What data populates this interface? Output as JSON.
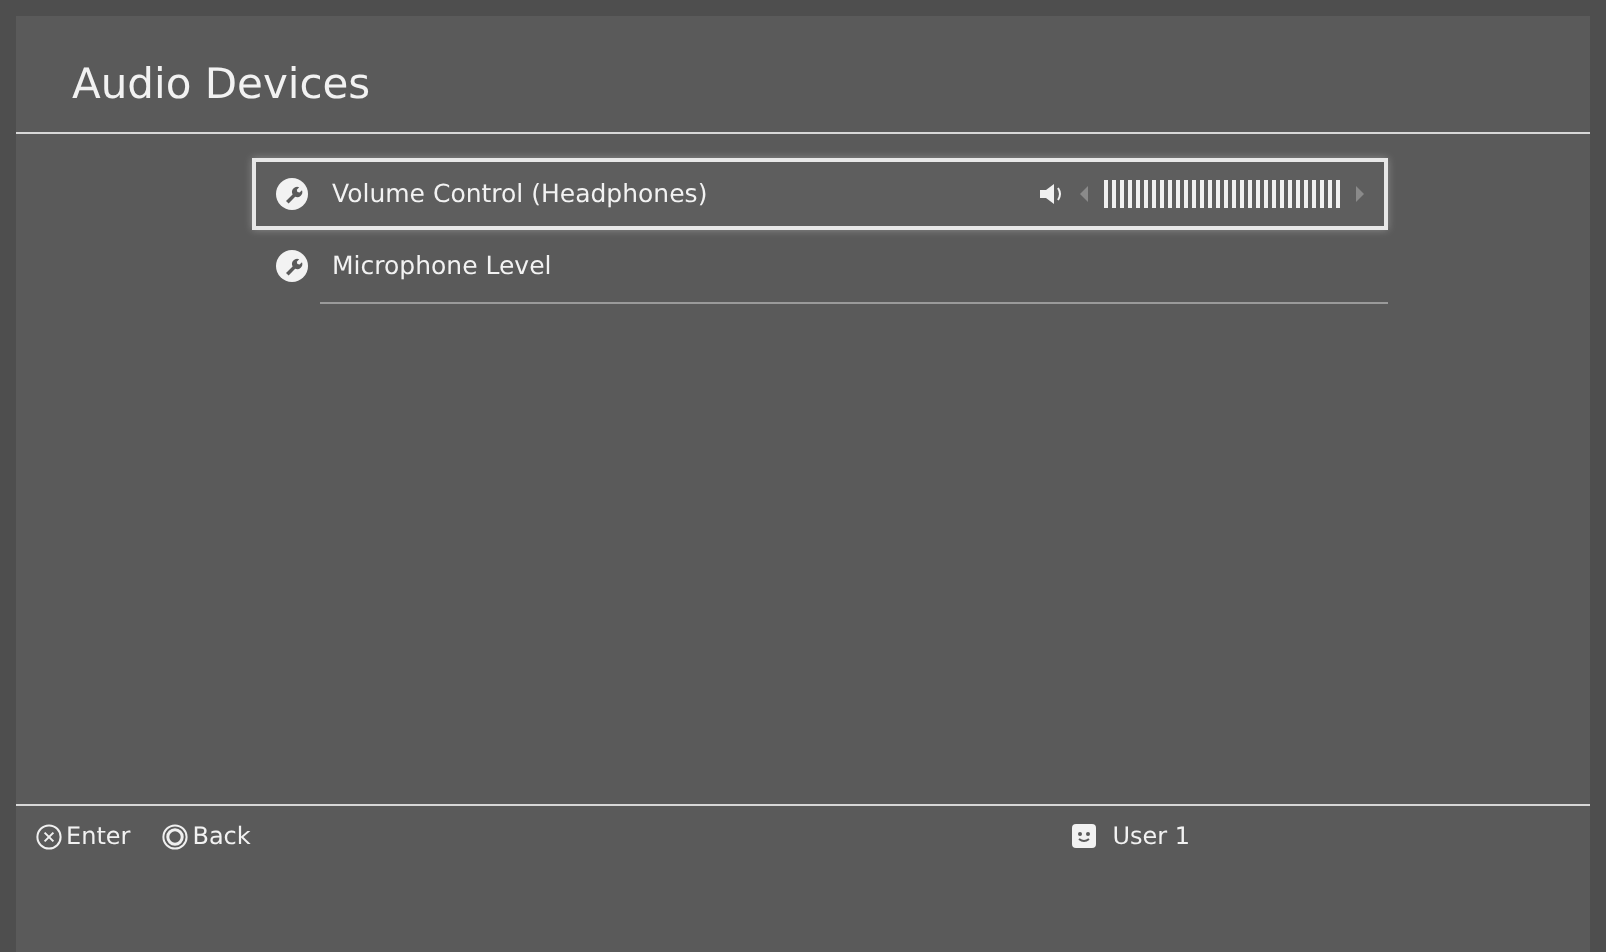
{
  "title": "Audio Devices",
  "items": [
    {
      "label": "Volume Control (Headphones)",
      "selected": true,
      "kind": "slider"
    },
    {
      "label": "Microphone Level",
      "selected": false,
      "kind": "plain"
    }
  ],
  "footer": {
    "buttons": [
      {
        "kind": "cross",
        "label": "Enter"
      },
      {
        "kind": "circle",
        "label": "Back"
      }
    ],
    "user": "User 1"
  }
}
